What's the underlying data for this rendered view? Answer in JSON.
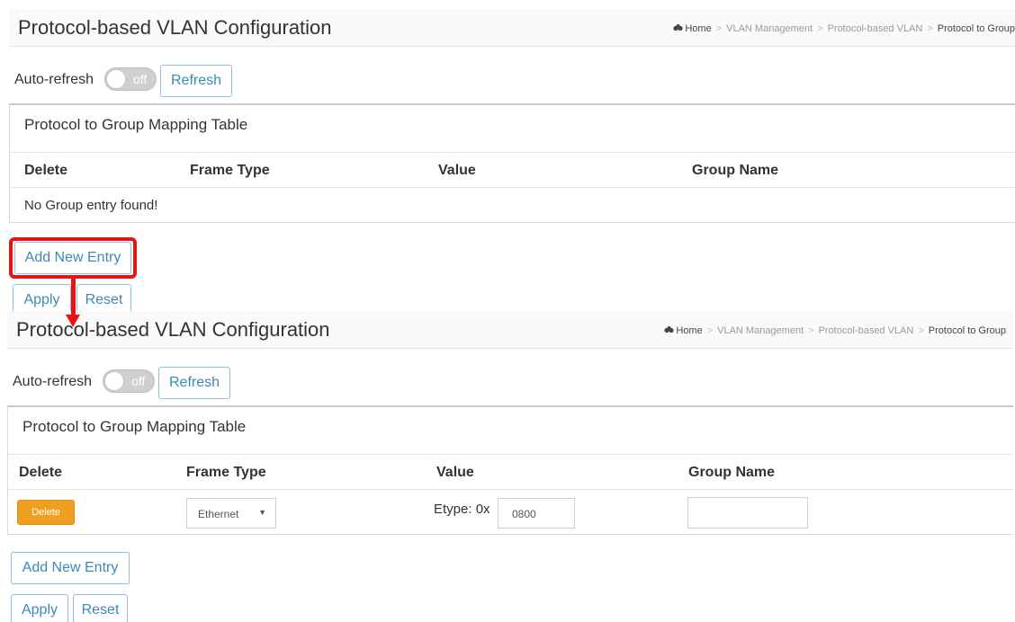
{
  "colors": {
    "accent": "#3d88b8",
    "delete_button": "#f0a020",
    "highlight": "#e81313"
  },
  "before": {
    "page_title": "Protocol-based VLAN Configuration",
    "breadcrumb": {
      "home": "Home",
      "vlan_management": "VLAN Management",
      "protocol_vlan": "Protocol-based VLAN",
      "current": "Protocol to Group"
    },
    "auto_refresh_label": "Auto-refresh",
    "toggle_state": "off",
    "refresh_label": "Refresh",
    "table_title": "Protocol to Group Mapping Table",
    "columns": [
      "Delete",
      "Frame Type",
      "Value",
      "Group Name"
    ],
    "empty_message": "No Group entry found!",
    "add_entry_label": "Add New Entry",
    "apply_label": "Apply",
    "reset_label": "Reset"
  },
  "after": {
    "page_title": "Protocol-based VLAN Configuration",
    "breadcrumb": {
      "home": "Home",
      "vlan_management": "VLAN Management",
      "protocol_vlan": "Protocol-based VLAN",
      "current": "Protocol to Group"
    },
    "auto_refresh_label": "Auto-refresh",
    "toggle_state": "off",
    "refresh_label": "Refresh",
    "table_title": "Protocol to Group Mapping Table",
    "columns": [
      "Delete",
      "Frame Type",
      "Value",
      "Group Name"
    ],
    "row": {
      "delete_label": "Delete",
      "frame_type": "Ethernet",
      "frame_type_icon": "caret-down-icon",
      "etype_label": "Etype: 0x",
      "etype_value": "0800",
      "group_name": ""
    },
    "add_entry_label": "Add New Entry",
    "apply_label": "Apply",
    "reset_label": "Reset"
  },
  "annotation": {
    "shape": "red rounded rectangle around Add New Entry button with arrow pointing down to the resulting page"
  }
}
